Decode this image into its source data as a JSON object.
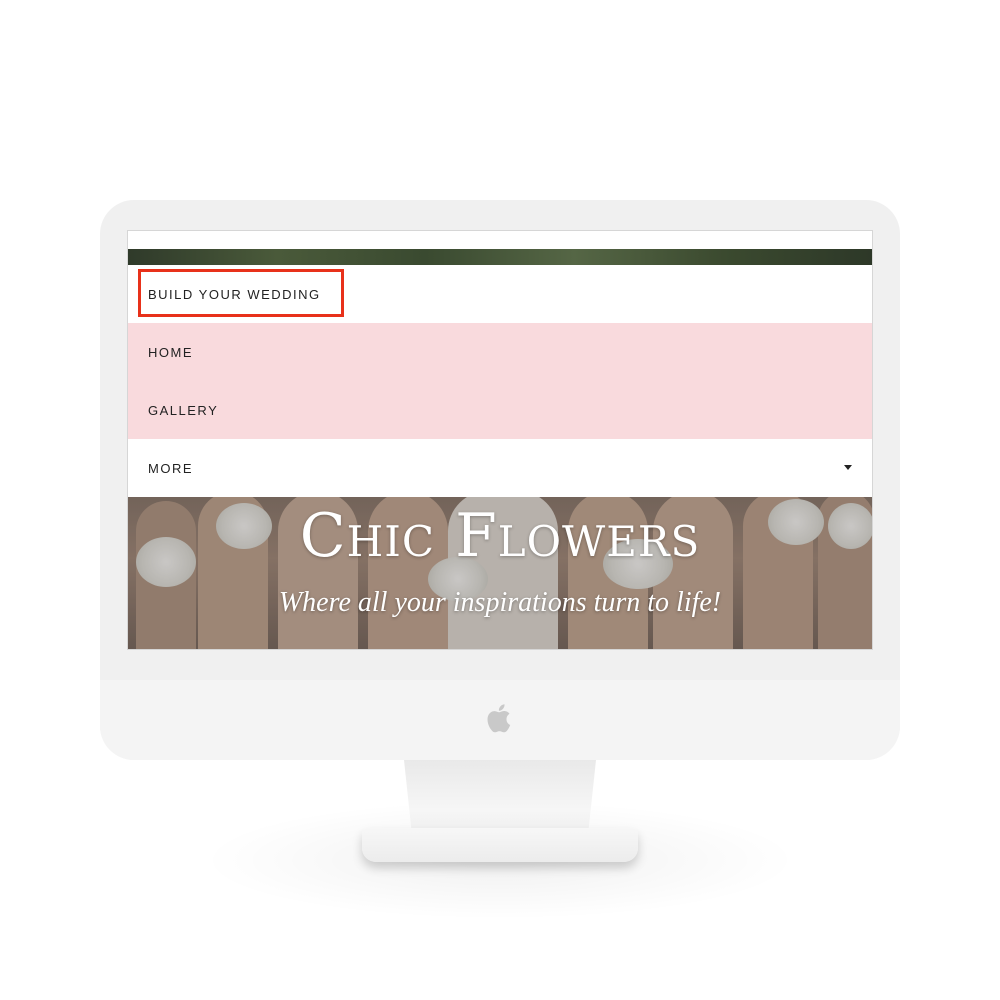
{
  "nav": {
    "items": [
      {
        "label": "BUILD YOUR WEDDING",
        "selected": true
      },
      {
        "label": "HOME",
        "selected": false
      },
      {
        "label": "GALLERY",
        "selected": false
      },
      {
        "label": "MORE",
        "selected": false
      }
    ]
  },
  "hero": {
    "title": "Chic Flowers",
    "subtitle": "Where all your inspirations turn to life!"
  },
  "colors": {
    "nav_highlight_bg": "#f9dadd",
    "annotation_box": "#e8311a",
    "monitor_body": "#f0f0f0"
  },
  "icons": {
    "more_caret": "caret-down-icon",
    "device_logo": "apple-logo-icon"
  }
}
